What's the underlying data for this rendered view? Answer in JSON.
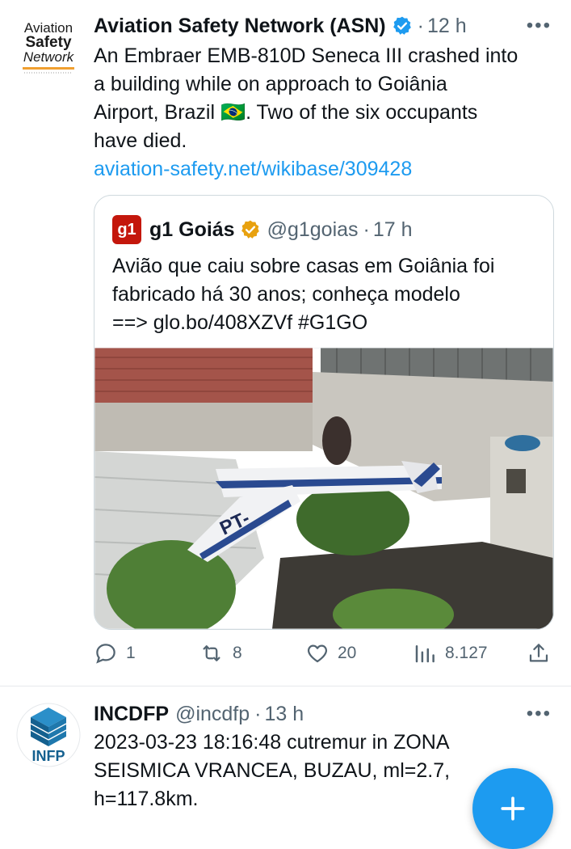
{
  "tweets": [
    {
      "author": {
        "name": "Aviation Safety Network (ASN)",
        "verified": true,
        "logo_lines": [
          "Aviation",
          "Safety",
          "Network"
        ]
      },
      "time": "12 h",
      "text": "An Embraer EMB-810D Seneca III crashed into a building while on approach to Goiânia Airport, Brazil 🇧🇷. Two of the six occupants have died.",
      "text_lines": [
        "An Embraer EMB-810D Seneca III crashed into",
        "a building while on approach to Goiânia",
        "Airport, Brazil 🇧🇷. Two of the six occupants",
        "have died."
      ],
      "link": "aviation-safety.net/wikibase/309428",
      "quote": {
        "logo": "g1",
        "name": "g1 Goiás",
        "handle": "@g1goias",
        "time": "17 h",
        "text_lines": [
          "Avião que caiu sobre casas em Goiânia foi",
          "fabricado há 30 anos; conheça modelo",
          "==> glo.bo/408XZVf #G1GO"
        ],
        "plane_registration": "PT-"
      },
      "actions": {
        "replies": "1",
        "retweets": "8",
        "likes": "20",
        "views": "8.127"
      }
    },
    {
      "author": {
        "name": "INCDFP",
        "handle": "@incdfp",
        "logo": "INFP"
      },
      "time": "13 h",
      "text_lines": [
        "2023-03-23 18:16:48 cutremur in ZONA",
        "SEISMICA VRANCEA, BUZAU, ml=2.7,",
        "h=117.8km."
      ]
    }
  ],
  "colors": {
    "accent": "#1d9bf0",
    "muted": "#536471",
    "text": "#0f1419",
    "gold_badge": "#e8a10f",
    "g1_red": "#c4170c"
  },
  "icons": [
    "verified-badge-icon",
    "more-icon",
    "reply-icon",
    "retweet-icon",
    "like-icon",
    "views-icon",
    "share-icon",
    "compose-plus-icon"
  ]
}
